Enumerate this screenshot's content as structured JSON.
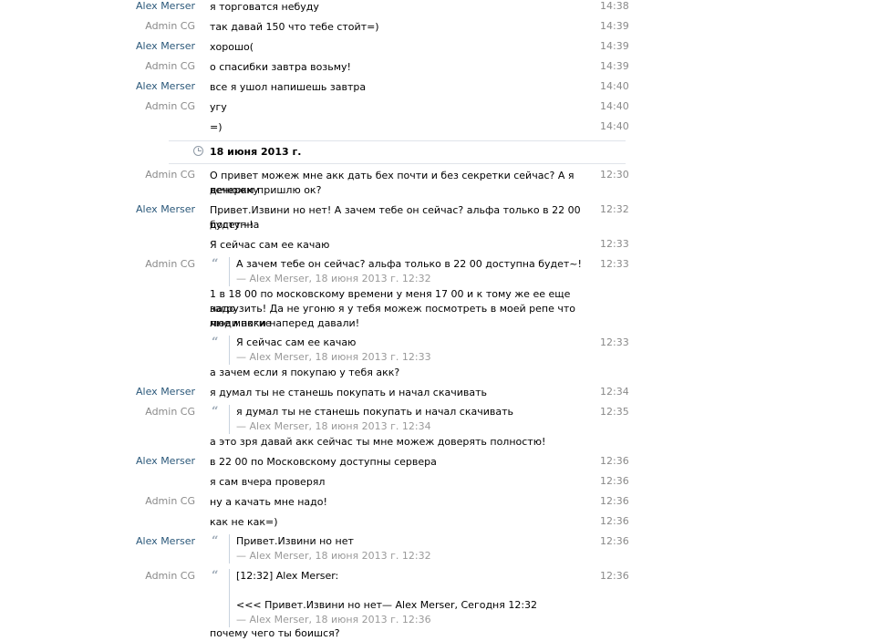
{
  "messages": [
    {
      "sender": "Alex Merser",
      "text": "я торговатся небуду",
      "time": "14:38"
    },
    {
      "sender": "Admin CG",
      "text": "так давай 150 что тебе стойт=)",
      "time": "14:39"
    },
    {
      "sender": "Alex Merser",
      "text": "хорошо(",
      "time": "14:39"
    },
    {
      "sender": "Admin CG",
      "text": "о спасибки завтра возьму!",
      "time": "14:39"
    },
    {
      "sender": "Alex Merser",
      "text": "все я ушол напишешь завтра",
      "time": "14:40"
    },
    {
      "sender": "Admin CG",
      "text": "угу",
      "time": "14:40"
    },
    {
      "sender": "",
      "text": "=)",
      "time": "14:40"
    }
  ],
  "day_separator": {
    "label": "18 июня 2013 г."
  },
  "messages2": {
    "m1": {
      "sender": "Admin CG",
      "line1": "О привет можеж мне акк дать бех почти и без секретки сейчас? А я денюжку",
      "line2": "вечером пришлю ок?",
      "time": "12:30"
    },
    "m2": {
      "sender": "Alex Merser",
      "line1": "Привет.Извини но нет! А зачем тебе он сейчас? альфа только в 22 00 доступна",
      "line2": "будет~!",
      "time": "12:32"
    },
    "m3": {
      "text": "Я сейчас сам ее качаю",
      "time": "12:33"
    },
    "m4": {
      "sender": "Admin CG",
      "quote_text": "А зачем тебе он сейчас? альфа только в 22 00 доступна будет~!",
      "quote_meta": "— Alex Merser, 18 июня 2013 г. 12:32",
      "time": "12:33",
      "line1": "1 в 18 00 по московскому времени у меня 17 00 и к тому же ее еще надо",
      "line2": "загрузить! Да не угоню я у тебя можеж посмотреть в моей репе что мне многие",
      "line3": "люди акки наперед давали!"
    },
    "m5": {
      "quote_text": "Я сейчас сам ее качаю",
      "quote_meta": "— Alex Merser, 18 июня 2013 г. 12:33",
      "time": "12:33",
      "text": "а зачем если я покупаю у тебя акк?"
    },
    "m6": {
      "sender": "Alex Merser",
      "text": "я думал ты не станешь покупать и начал скачивать",
      "time": "12:34"
    },
    "m7": {
      "sender": "Admin CG",
      "quote_text": "я думал ты не станешь покупать и начал скачивать",
      "quote_meta": "— Alex Merser, 18 июня 2013 г. 12:34",
      "time": "12:35",
      "text": "а это зря давай акк сейчас ты мне можеж доверять полностю!"
    },
    "m8": {
      "sender": "Alex Merser",
      "text": "в 22 00 по Московскому доступны сервера",
      "time": "12:36"
    },
    "m9": {
      "text": "я сам вчера проверял",
      "time": "12:36"
    },
    "m10": {
      "sender": "Admin CG",
      "text": "ну а качать мне надо!",
      "time": "12:36"
    },
    "m11": {
      "text": "как не как=)",
      "time": "12:36"
    },
    "m12": {
      "sender": "Alex Merser",
      "quote_text": "Привет.Извини но нет",
      "quote_meta": "— Alex Merser, 18 июня 2013 г. 12:32",
      "time": "12:36"
    },
    "m13": {
      "sender": "Admin CG",
      "quote_line1": "[12:32] Alex Merser:",
      "quote_line2": "<<< Привет.Извини но нет— Alex Merser, Сегодня 12:32",
      "quote_meta": "— Alex Merser, 18 июня 2013 г. 12:36",
      "time": "12:36",
      "text": "почему чего ты боишся?"
    }
  },
  "icons": {
    "quote": "quote-icon",
    "clock": "clock-icon"
  },
  "colors": {
    "alex": "#2b587a",
    "admin": "#8a8a8a",
    "time": "#8a8a8a"
  }
}
